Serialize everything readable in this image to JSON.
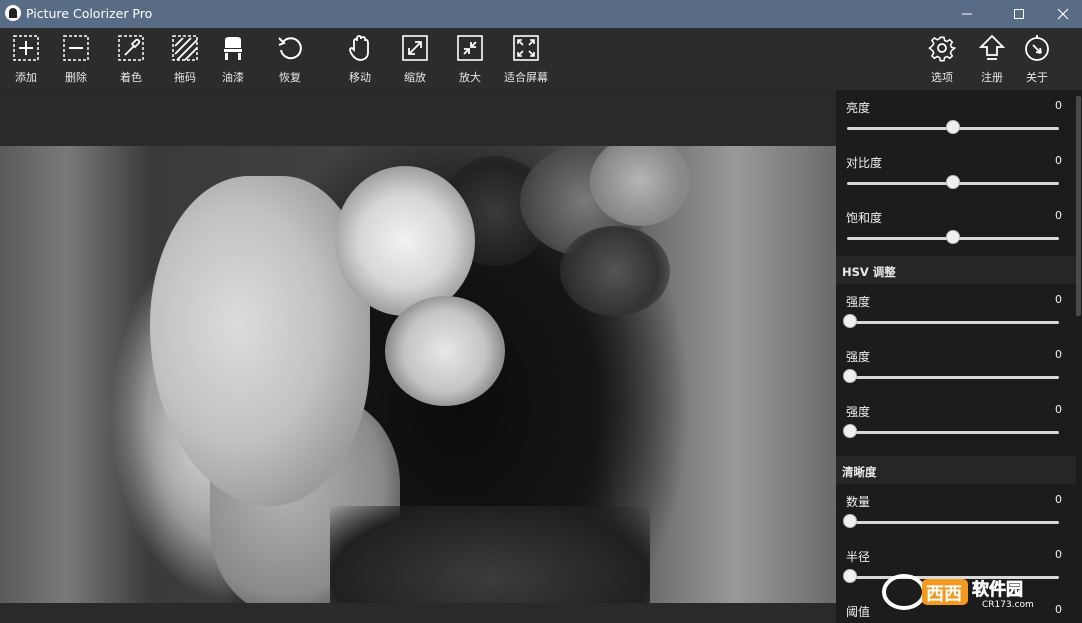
{
  "window": {
    "title": "Picture Colorizer Pro"
  },
  "toolbar": {
    "left": [
      {
        "label": "添加",
        "icon": "add-icon"
      },
      {
        "label": "删除",
        "icon": "remove-icon"
      },
      {
        "label": "着色",
        "icon": "eyedropper-icon"
      },
      {
        "label": "拖码",
        "icon": "hatch-icon"
      },
      {
        "label": "油漆",
        "icon": "paint-bucket-icon"
      },
      {
        "label": "恢复",
        "icon": "undo-icon"
      },
      {
        "label": "移动",
        "icon": "hand-icon"
      },
      {
        "label": "缩放",
        "icon": "expand-icon"
      },
      {
        "label": "放大",
        "icon": "shrink-icon"
      },
      {
        "label": "适合屏幕",
        "icon": "fit-screen-icon"
      }
    ],
    "right": [
      {
        "label": "选项",
        "icon": "gear-icon"
      },
      {
        "label": "注册",
        "icon": "upload-arrow-icon"
      },
      {
        "label": "关于",
        "icon": "compass-icon"
      }
    ]
  },
  "panel": {
    "brightness": {
      "label": "亮度",
      "value": "0",
      "fraction": 0.5
    },
    "contrast": {
      "label": "对比度",
      "value": "0",
      "fraction": 0.5
    },
    "saturation": {
      "label": "饱和度",
      "value": "0",
      "fraction": 0.5
    },
    "hsv_header": "HSV 调整",
    "hsv1": {
      "label": "强度",
      "value": "0",
      "fraction": 0
    },
    "hsv2": {
      "label": "强度",
      "value": "0",
      "fraction": 0
    },
    "hsv3": {
      "label": "强度",
      "value": "0",
      "fraction": 0
    },
    "sharpness_header": "清晰度",
    "amount": {
      "label": "数量",
      "value": "0",
      "fraction": 0
    },
    "radius": {
      "label": "半径",
      "value": "0",
      "fraction": 0
    },
    "threshold": {
      "label": "阈值",
      "value": "0"
    }
  },
  "watermark": {
    "text": "软件园",
    "url": "CR173.com"
  },
  "colors": {
    "titlebar": "#586c86",
    "toolbar": "#2c2c2c",
    "panel": "#1c1c1c",
    "accent_orange": "#f39a1e"
  }
}
